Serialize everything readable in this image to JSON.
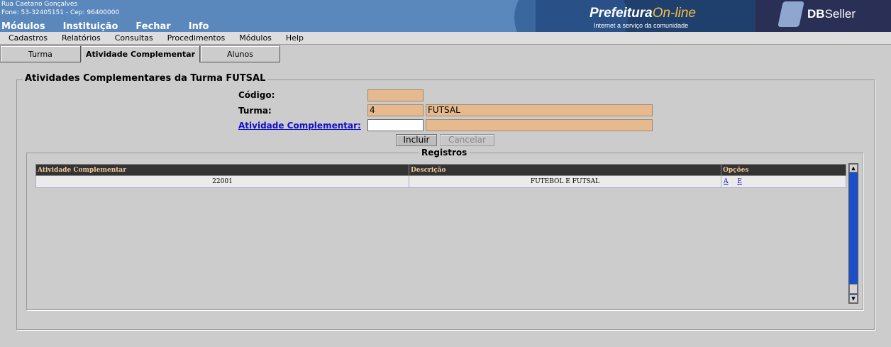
{
  "header": {
    "address_line": "Rua Caetano Gonçalves",
    "contact_line": "Fone: 53-32405151  -  Cep: 96400000",
    "top_menu": [
      "Módulos",
      "Instituição",
      "Fechar",
      "Info"
    ],
    "brand_main": "Prefeitura",
    "brand_accent": "On-line",
    "tagline": "Internet a serviço da comunidade",
    "vendor_bold": "DB",
    "vendor_rest": "Seller"
  },
  "menubar": [
    "Cadastros",
    "Relatórios",
    "Consultas",
    "Procedimentos",
    "Módulos",
    "Help"
  ],
  "tabs": [
    {
      "label": "Turma"
    },
    {
      "label": "Atividade Complementar"
    },
    {
      "label": "Alunos"
    }
  ],
  "form": {
    "legend": "Atividades Complementares da Turma FUTSAL",
    "codigo_label": "Código:",
    "codigo_value": "",
    "turma_label": "Turma:",
    "turma_code": "4",
    "turma_name": "FUTSAL",
    "atividade_label": "Atividade Complementar:",
    "atividade_code": "",
    "atividade_desc": "",
    "incluir": "Incluir",
    "cancelar": "Cancelar"
  },
  "registros": {
    "legend": "Registros",
    "columns": [
      "Atividade Complementar",
      "Descrição",
      "Opções"
    ],
    "rows": [
      {
        "codigo": "22001",
        "descricao": "FUTEBOL E FUTSAL",
        "alterar": "A",
        "excluir": "E"
      }
    ]
  },
  "colors": {
    "banner": "#5a88bd",
    "input_readonly": "#e6b98e",
    "grid_header": "#333333",
    "grid_header_text": "#f0c89a",
    "scrollbar": "#1c4fc7"
  }
}
